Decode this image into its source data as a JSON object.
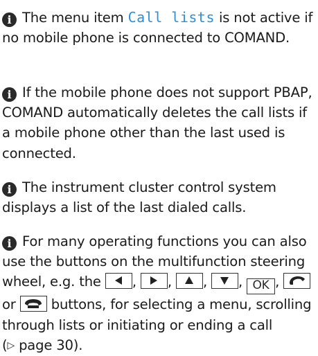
{
  "notes": [
    {
      "before": "The menu item",
      "menu_item": "Call lists",
      "after": "is not active if no mobile phone is connected to COMAND."
    },
    {
      "text": "If the mobile phone does not support PBAP, COMAND automatically deletes the call lists if a mobile phone other than the last used is connected."
    },
    {
      "text": "The instrument cluster control system displays a list of the last dialed calls."
    },
    {
      "part1": "For many operating functions you can also use the buttons on the multifunction steering wheel, e.g. the",
      "key_left": "left-arrow-button",
      "key_right": "right-arrow-button",
      "key_up": "up-arrow-button",
      "key_down": "down-arrow-button",
      "ok_label": "OK",
      "or_label": "or",
      "key_phone_pickup": "phone-pickup-button",
      "key_phone_hangup": "phone-hangup-button",
      "part2": "buttons, for selecting a menu, scrolling through lists or initiating or ending a call (",
      "ref_arrow": "▷",
      "ref_page": "page 30",
      "part3": ")."
    }
  ],
  "colors": {
    "menu_item": "#2d8ed8",
    "text": "#1a1a1a",
    "icon": "#2a2a2a"
  }
}
